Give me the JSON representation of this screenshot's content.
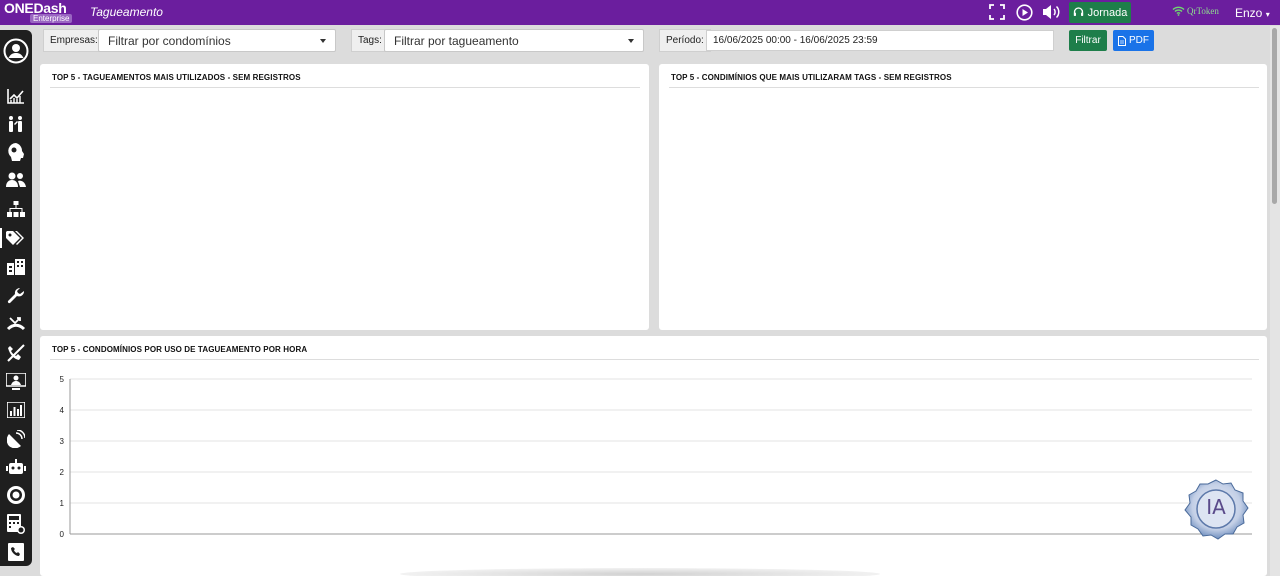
{
  "app": {
    "logo_main": "ONEDash",
    "logo_sub": "Enterprise",
    "page_title": "Tagueamento"
  },
  "topbar": {
    "jornada_label": "Jornada",
    "qrtoken_label": "QrToken",
    "user_name": "Enzo",
    "icons": [
      "fullscreen-icon",
      "play-icon",
      "volume-icon"
    ]
  },
  "sidebar": {
    "items": [
      "user-avatar-icon",
      "line-chart-icon",
      "people-icon",
      "head-icon",
      "group-icon",
      "hierarchy-icon",
      "tags-icon",
      "buildings-icon",
      "wrench-icon",
      "missed-call-icon",
      "no-call-icon",
      "presentation-icon",
      "bar-chart-icon",
      "satellite-icon",
      "robot-icon",
      "globe-icon",
      "calculator-icon",
      "phone-book-icon"
    ],
    "active": "tags-icon"
  },
  "filters": {
    "empresas_label": "Empresas:",
    "empresas_value": "Filtrar por condomínios",
    "tags_label": "Tags:",
    "tags_value": "Filtrar por tagueamento",
    "periodo_label": "Período:",
    "periodo_value": "16/06/2025 00:00 - 16/06/2025 23:59",
    "filtrar_label": "Filtrar",
    "pdf_label": "PDF"
  },
  "panels": {
    "top_tags_title": "TOP 5 - TAGUEAMENTOS MAIS UTILIZADOS - SEM REGISTROS",
    "top_condominios_title": "TOP 5 - CONDIMÍNIOS QUE MAIS UTILIZARAM TAGS - SEM REGISTROS",
    "hourly_title": "TOP 5 - CONDOMÍNIOS POR USO DE TAGUEAMENTO POR HORA"
  },
  "ia_badge": "IA",
  "colors": {
    "topbar": "#6b1e9e",
    "jornada": "#1e7e4a",
    "filtrar": "#1e7e4a",
    "pdf": "#1a73e8",
    "sidebar": "#1f1f1f"
  },
  "chart_data": {
    "type": "line",
    "title": "TOP 5 - CONDOMÍNIOS POR USO DE TAGUEAMENTO POR HORA",
    "xlabel": "",
    "ylabel": "",
    "ylim": [
      0,
      5
    ],
    "yticks": [
      0,
      1,
      2,
      3,
      4,
      5
    ],
    "grid": true,
    "series": []
  }
}
